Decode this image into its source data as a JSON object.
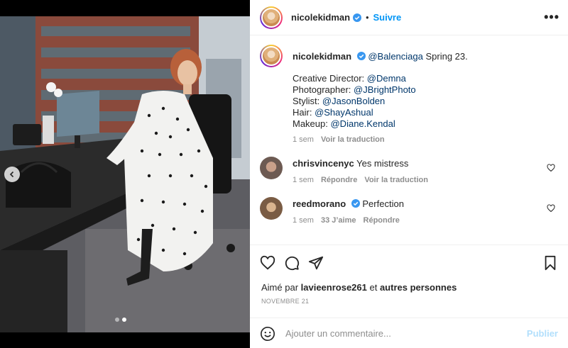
{
  "post": {
    "username": "nicolekidman",
    "follow_label": "Suivre",
    "more_label": "•••",
    "separator": "•",
    "image_count": 2,
    "active_image": 1
  },
  "caption": {
    "username": "nicolekidman",
    "lead_mention": "@Balenciaga",
    "lead_text": " Spring 23.",
    "credits": [
      {
        "label": "Creative Director: ",
        "handle": "@Demna"
      },
      {
        "label": "Photographer: ",
        "handle": "@JBrightPhoto"
      },
      {
        "label": "Stylist: ",
        "handle": "@JasonBolden"
      },
      {
        "label": "Hair: ",
        "handle": "@ShayAshual"
      },
      {
        "label": "Makeup: ",
        "handle": "@Diane.Kendal"
      }
    ],
    "time": "1 sem",
    "translate": "Voir la traduction"
  },
  "comments": [
    {
      "username": "chrisvincenyc",
      "text": "Yes mistress",
      "time": "1 sem",
      "reply": "Répondre",
      "translate": "Voir la traduction",
      "likes": ""
    },
    {
      "username": "reedmorano",
      "text": "Perfection",
      "time": "1 sem",
      "likes": "33 J’aime",
      "reply": "Répondre"
    }
  ],
  "actions": {
    "liked_by_prefix": "Aimé par ",
    "liked_by_user": "lavieenrose261",
    "liked_by_and": " et ",
    "liked_by_others": "autres personnes",
    "date": "NOVEMBRE 21"
  },
  "composer": {
    "placeholder": "Ajouter un commentaire...",
    "publish_label": "Publier"
  },
  "colors": {
    "accent": "#0095f6",
    "verified": "#3897f0",
    "publish_disabled": "#b2dffc"
  },
  "icons": [
    "chevron-left-icon",
    "more-icon",
    "verified-icon",
    "heart-icon",
    "comment-icon",
    "share-icon",
    "bookmark-icon",
    "emoji-icon"
  ]
}
